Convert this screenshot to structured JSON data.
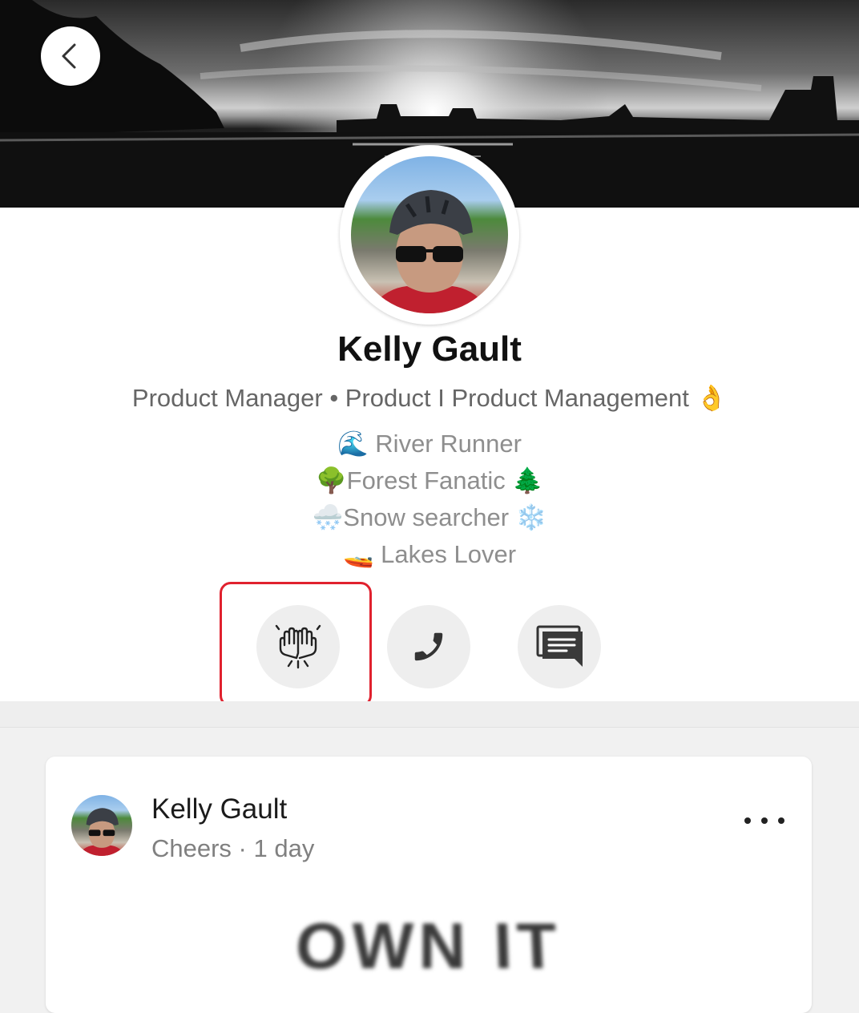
{
  "profile": {
    "name": "Kelly Gault",
    "title": "Product Manager • Product I Product Management 👌",
    "bio": [
      "🌊 River Runner",
      "🌳Forest Fanatic 🌲",
      "🌨️Snow searcher ❄️",
      "🚤 Lakes Lover"
    ]
  },
  "actions": [
    {
      "name": "high-five-button",
      "icon": "high-five-icon"
    },
    {
      "name": "call-button",
      "icon": "phone-icon"
    },
    {
      "name": "message-button",
      "icon": "chat-icon"
    }
  ],
  "post": {
    "author": "Kelly Gault",
    "meta": "Cheers · 1 day",
    "image_text": "OWN IT"
  },
  "colors": {
    "highlight": "#e0212e",
    "action_bg": "#eeeeee"
  }
}
